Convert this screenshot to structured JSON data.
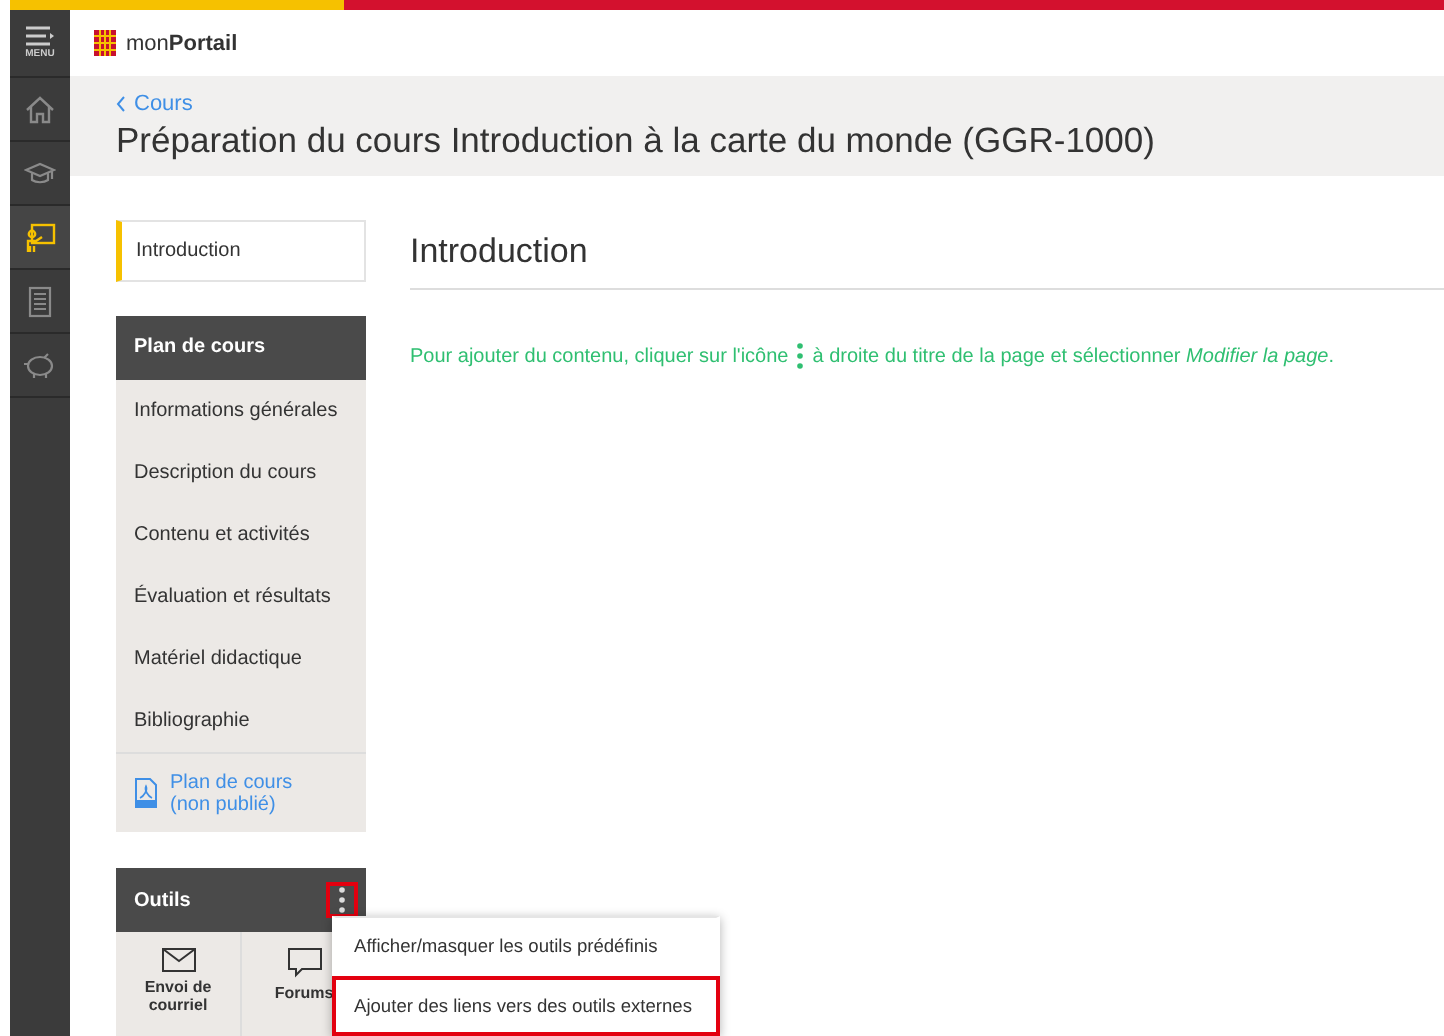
{
  "rail": {
    "menu_label": "MENU",
    "items": [
      {
        "kind": "home",
        "selected": false
      },
      {
        "kind": "cap",
        "selected": false
      },
      {
        "kind": "board",
        "selected": true
      },
      {
        "kind": "document",
        "selected": false
      },
      {
        "kind": "piggy",
        "selected": false
      }
    ]
  },
  "header": {
    "logo_text": "mon**Portail**"
  },
  "page": {
    "breadcrumb": "Cours",
    "title": "Préparation du cours Introduction à la carte du monde (GGR-1000)"
  },
  "course_nav": {
    "intro": {
      "label": "Introduction",
      "selected": true
    },
    "plan_header": "Plan de cours",
    "items": [
      {
        "label": "Informations générales",
        "selected": false
      },
      {
        "label": "Description du cours",
        "selected": false
      },
      {
        "label": "Contenu et activités",
        "selected": false
      },
      {
        "label": "Évaluation et résultats",
        "selected": false
      },
      {
        "label": "Matériel didactique",
        "selected": false
      },
      {
        "label": "Bibliographie",
        "selected": false
      }
    ],
    "pdf_link": "Plan de cours (non publié)",
    "tools_header": "Outils",
    "tools_menu_highlighted": true,
    "tools": [
      {
        "kind": "mail",
        "label": "Envoi de courriel"
      },
      {
        "kind": "forum",
        "label": "Forums"
      }
    ]
  },
  "main": {
    "heading": "Introduction",
    "instruction_before": "Pour ajouter du contenu, cliquer sur l'icône",
    "instruction_after": "à droite du titre de la page et sélectionner *Modifier la page*."
  },
  "tools_menu": {
    "items": [
      {
        "label": "Afficher/masquer les outils prédéfinis",
        "highlighted": false
      },
      {
        "label": "Ajouter des liens vers des outils externes",
        "highlighted": true
      }
    ]
  }
}
